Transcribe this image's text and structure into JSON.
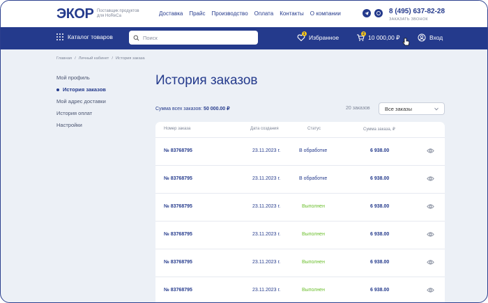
{
  "header": {
    "logo": "ЭКОР",
    "tagline_line1": "Поставщик продуктов",
    "tagline_line2": "для HoReCa",
    "nav": [
      "Доставка",
      "Прайс",
      "Производство",
      "Оплата",
      "Контакты",
      "О компании"
    ],
    "phone": "8 (495) 637-82-28",
    "callback": "ЗАКАЗАТЬ ЗВОНОК"
  },
  "bar": {
    "catalog": "Каталог товаров",
    "search_placeholder": "Поиск",
    "favorites": "Избранное",
    "favorites_badge": "1",
    "cart_total": "10 000,00 ₽",
    "cart_badge": "2",
    "login": "Вход"
  },
  "breadcrumbs": [
    "Главная",
    "/",
    "Личный кабинет",
    "/",
    "История заказа"
  ],
  "sidebar": {
    "items": [
      {
        "label": "Мой профиль"
      },
      {
        "label": "История заказов"
      },
      {
        "label": "Мой адрес доставки"
      },
      {
        "label": "История оплат"
      },
      {
        "label": "Настройки"
      }
    ]
  },
  "main": {
    "title": "История заказов",
    "sum_label": "Сумма всех заказов:",
    "sum_value": "50 000.00 ₽",
    "count": "20 заказов",
    "filter_value": "Все заказы"
  },
  "table": {
    "headers": [
      "Номер заказа",
      "Дата создания",
      "Статус",
      "Сумма заказа, ₽"
    ],
    "rows": [
      {
        "num": "№ 83768795",
        "date": "23.11.2023 г.",
        "status": "В обработке",
        "sum": "6 938.00"
      },
      {
        "num": "№ 83768795",
        "date": "23.11.2023 г.",
        "status": "В обработке",
        "sum": "6 938.00"
      },
      {
        "num": "№ 83768795",
        "date": "23.11.2023 г.",
        "status": "Выполнен",
        "sum": "6 938.00"
      },
      {
        "num": "№ 83768795",
        "date": "23.11.2023 г.",
        "status": "Выполнен",
        "sum": "6 938.00"
      },
      {
        "num": "№ 83768795",
        "date": "23.11.2023 г.",
        "status": "Выполнен",
        "sum": "6 938.00"
      },
      {
        "num": "№ 83768795",
        "date": "23.11.2023 г.",
        "status": "Выполнен",
        "sum": "6 938.00"
      }
    ]
  },
  "colors": {
    "brand": "#243a8c",
    "accent": "#f5a623",
    "status_processing": "#243a8c",
    "status_done": "#6cbf2e",
    "background": "#ecf0f6"
  },
  "icons": [
    "telegram-icon",
    "whatsapp-icon",
    "grid-icon",
    "search-icon",
    "heart-icon",
    "cart-icon",
    "user-icon",
    "chevron-down-icon",
    "eye-icon",
    "cursor-hand-icon"
  ]
}
